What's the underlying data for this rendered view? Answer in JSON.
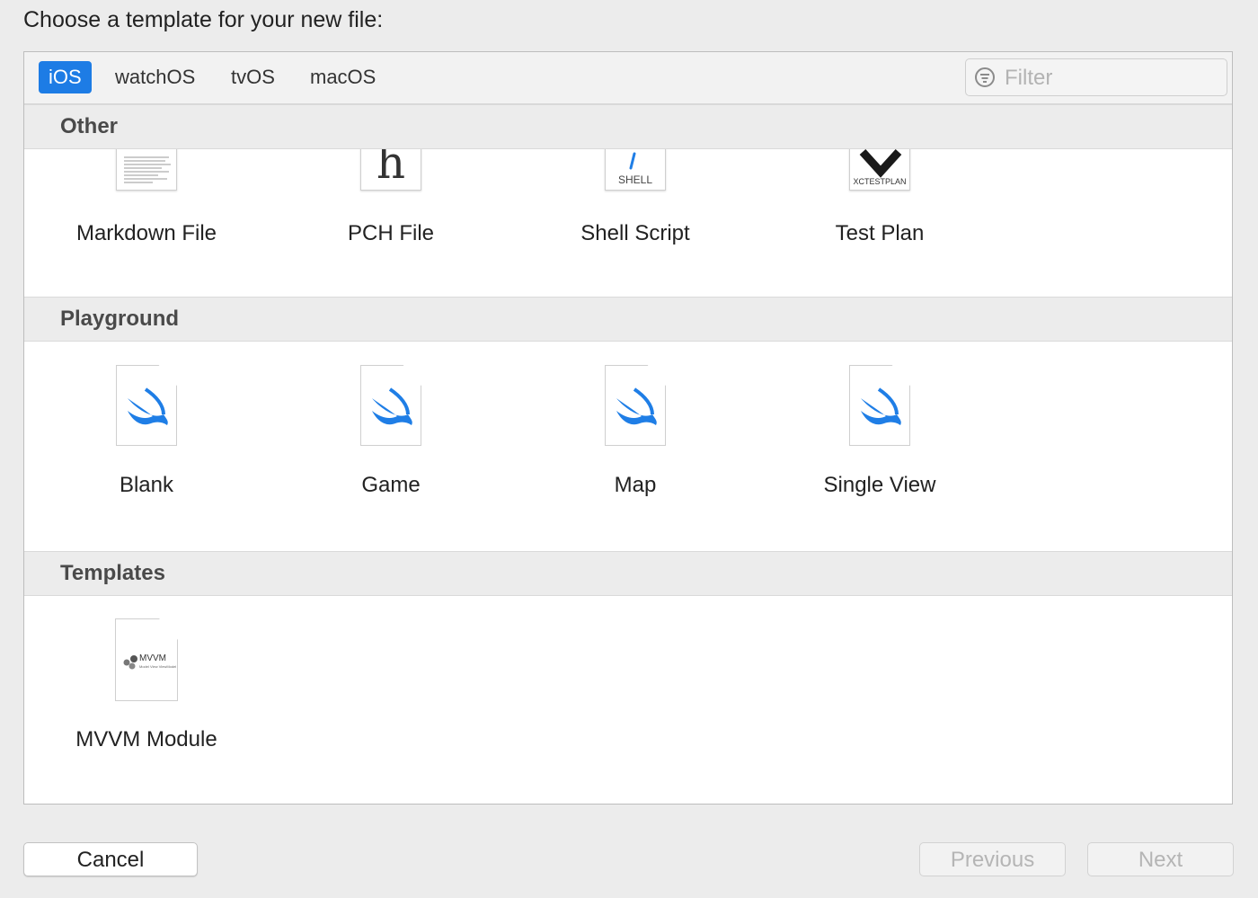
{
  "dialog": {
    "title": "Choose a template for your new file:"
  },
  "tabs": [
    {
      "label": "iOS",
      "active": true
    },
    {
      "label": "watchOS",
      "active": false
    },
    {
      "label": "tvOS",
      "active": false
    },
    {
      "label": "macOS",
      "active": false
    }
  ],
  "filter": {
    "placeholder": "Filter",
    "value": ""
  },
  "sections": [
    {
      "title": "Other",
      "items": [
        {
          "label": "Markdown File",
          "icon": "markdown-file-icon"
        },
        {
          "label": "PCH File",
          "icon": "pch-file-icon",
          "glyph": "h"
        },
        {
          "label": "Shell Script",
          "icon": "shell-script-icon",
          "glyph": "SHELL"
        },
        {
          "label": "Test Plan",
          "icon": "test-plan-icon",
          "glyph": "XCTESTPLAN"
        }
      ]
    },
    {
      "title": "Playground",
      "items": [
        {
          "label": "Blank",
          "icon": "swift-file-icon"
        },
        {
          "label": "Game",
          "icon": "swift-file-icon"
        },
        {
          "label": "Map",
          "icon": "swift-file-icon"
        },
        {
          "label": "Single View",
          "icon": "swift-file-icon"
        }
      ]
    },
    {
      "title": "Templates",
      "items": [
        {
          "label": "MVVM Module",
          "icon": "mvvm-template-icon",
          "glyph": "MVVM",
          "subtext": "Model View ViewModel"
        }
      ]
    }
  ],
  "footer": {
    "cancel_label": "Cancel",
    "previous_label": "Previous",
    "next_label": "Next"
  },
  "colors": {
    "accent": "#1d7ce5",
    "swift": "#1f7ee6",
    "disabled_text": "#b5b5b5"
  }
}
